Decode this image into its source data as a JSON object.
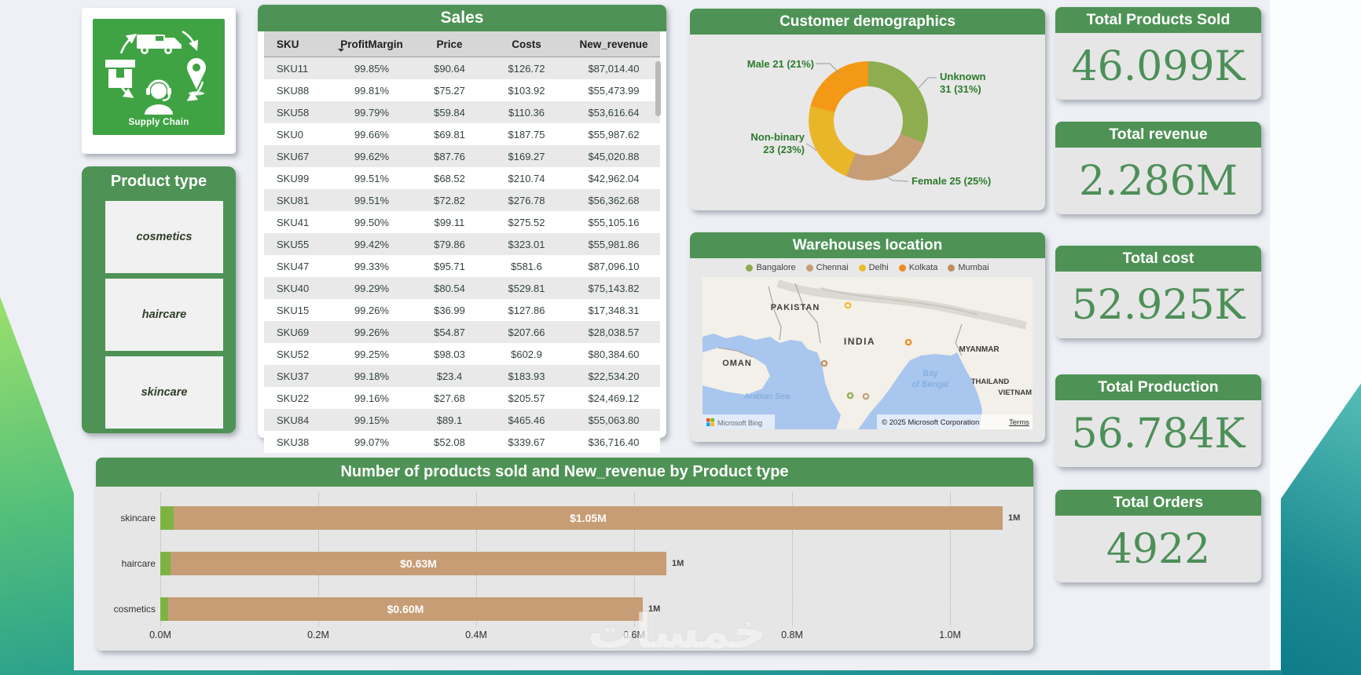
{
  "logo": {
    "caption": "Supply Chain"
  },
  "product_type": {
    "title": "Product type",
    "options": [
      "cosmetics",
      "haircare",
      "skincare"
    ]
  },
  "sales": {
    "title": "Sales",
    "columns": [
      "SKU",
      "ProfitMargin",
      "Price",
      "Costs",
      "New_revenue"
    ],
    "sorted_column": "ProfitMargin",
    "sort_direction": "desc",
    "rows": [
      [
        "SKU11",
        "99.85%",
        "$90.64",
        "$126.72",
        "$87,014.40"
      ],
      [
        "SKU88",
        "99.81%",
        "$75.27",
        "$103.92",
        "$55,473.99"
      ],
      [
        "SKU58",
        "99.79%",
        "$59.84",
        "$110.36",
        "$53,616.64"
      ],
      [
        "SKU0",
        "99.66%",
        "$69.81",
        "$187.75",
        "$55,987.62"
      ],
      [
        "SKU67",
        "99.62%",
        "$87.76",
        "$169.27",
        "$45,020.88"
      ],
      [
        "SKU99",
        "99.51%",
        "$68.52",
        "$210.74",
        "$42,962.04"
      ],
      [
        "SKU81",
        "99.51%",
        "$72.82",
        "$276.78",
        "$56,362.68"
      ],
      [
        "SKU41",
        "99.50%",
        "$99.11",
        "$275.52",
        "$55,105.16"
      ],
      [
        "SKU55",
        "99.42%",
        "$79.86",
        "$323.01",
        "$55,981.86"
      ],
      [
        "SKU47",
        "99.33%",
        "$95.71",
        "$581.6",
        "$87,096.10"
      ],
      [
        "SKU40",
        "99.29%",
        "$80.54",
        "$529.81",
        "$75,143.82"
      ],
      [
        "SKU15",
        "99.26%",
        "$36.99",
        "$127.86",
        "$17,348.31"
      ],
      [
        "SKU69",
        "99.26%",
        "$54.87",
        "$207.66",
        "$28,038.57"
      ],
      [
        "SKU52",
        "99.25%",
        "$98.03",
        "$602.9",
        "$80,384.60"
      ],
      [
        "SKU37",
        "99.18%",
        "$23.4",
        "$183.93",
        "$22,534.20"
      ],
      [
        "SKU22",
        "99.16%",
        "$27.68",
        "$205.57",
        "$24,469.12"
      ],
      [
        "SKU84",
        "99.15%",
        "$89.1",
        "$465.46",
        "$55,063.80"
      ],
      [
        "SKU38",
        "99.07%",
        "$52.08",
        "$339.67",
        "$36,716.40"
      ]
    ]
  },
  "demographics": {
    "title": "Customer demographics",
    "callouts": {
      "male": "Male 21 (21%)",
      "unknown1": "Unknown",
      "unknown2": "31 (31%)",
      "nb1": "Non-binary",
      "nb2": "23 (23%)",
      "female": "Female 25 (25%)"
    }
  },
  "warehouses": {
    "title": "Warehouses location",
    "legend": [
      {
        "name": "Bangalore",
        "color": "#8dad4e"
      },
      {
        "name": "Chennai",
        "color": "#c79d76"
      },
      {
        "name": "Delhi",
        "color": "#eebc2a"
      },
      {
        "name": "Kolkata",
        "color": "#ef8a1c"
      },
      {
        "name": "Mumbai",
        "color": "#c08d5e"
      }
    ],
    "map": {
      "countries": [
        "PAKISTAN",
        "INDIA",
        "OMAN",
        "MYANMAR",
        "THAILAND",
        "VIETNAM"
      ],
      "seas": [
        "Arabian Sea",
        "Bay",
        "of Bengal"
      ],
      "attribution": "© 2025 Microsoft Corporation",
      "terms_label": "Terms",
      "bing_label": "Microsoft Bing"
    }
  },
  "kpis": [
    {
      "title": "Total Products Sold",
      "value": "46.099K"
    },
    {
      "title": "Total revenue",
      "value": "2.286M"
    },
    {
      "title": "Total cost",
      "value": "52.925K"
    },
    {
      "title": "Total Production",
      "value": "56.784K"
    },
    {
      "title": "Total Orders",
      "value": "4922"
    }
  ],
  "bar_chart": {
    "title": "Number of products sold and New_revenue by Product type",
    "ticks": [
      "0.0M",
      "0.2M",
      "0.4M",
      "0.6M",
      "0.8M",
      "1.0M"
    ],
    "rows": [
      {
        "category": "skincare",
        "revenue_label": "$1.05M",
        "total_label": "1M",
        "revenue_m": 1.05,
        "sold_m": 0.017
      },
      {
        "category": "haircare",
        "revenue_label": "$0.63M",
        "total_label": "1M",
        "revenue_m": 0.628,
        "sold_m": 0.013
      },
      {
        "category": "cosmetics",
        "revenue_label": "$0.60M",
        "total_label": "1M",
        "revenue_m": 0.601,
        "sold_m": 0.01
      }
    ]
  },
  "chart_data": [
    {
      "type": "pie",
      "title": "Customer demographics",
      "labels": [
        "Unknown",
        "Female",
        "Non-binary",
        "Male"
      ],
      "values": [
        31,
        25,
        23,
        21
      ],
      "counts": [
        31,
        25,
        23,
        21
      ],
      "colors": [
        "#8dad4e",
        "#c79d76",
        "#e9b62a",
        "#f39915"
      ],
      "donut": true,
      "legend_position": "callouts"
    },
    {
      "type": "bar",
      "orientation": "horizontal",
      "title": "Number of products sold and New_revenue by Product type",
      "categories": [
        "skincare",
        "haircare",
        "cosmetics"
      ],
      "series": [
        {
          "name": "Number of products sold",
          "values": [
            0.017,
            0.013,
            0.01
          ],
          "color": "#7cb342"
        },
        {
          "name": "New_revenue",
          "values": [
            1.05,
            0.628,
            0.601
          ],
          "color": "#c79d76"
        }
      ],
      "data_labels": [
        "$1.05M",
        "$0.63M",
        "$0.60M"
      ],
      "total_labels": [
        "1M",
        "1M",
        "1M"
      ],
      "xlabel": "",
      "ylabel": "",
      "xlim": [
        0,
        1.16
      ],
      "unit": "M (USD)",
      "grid": "dotted-vertical"
    }
  ],
  "watermark": "خمسات",
  "colors": {
    "header_green": "#4e9355",
    "logo_green": "#3fa344",
    "kpi_value_green": "#4d8f58",
    "callout_green": "#2c7a2c",
    "bar_revenue_tan": "#c79d76",
    "bar_sold_green": "#7cb342",
    "deco_left_green": "#9ce06c",
    "deco_right_teal": "#0e7b8a"
  }
}
